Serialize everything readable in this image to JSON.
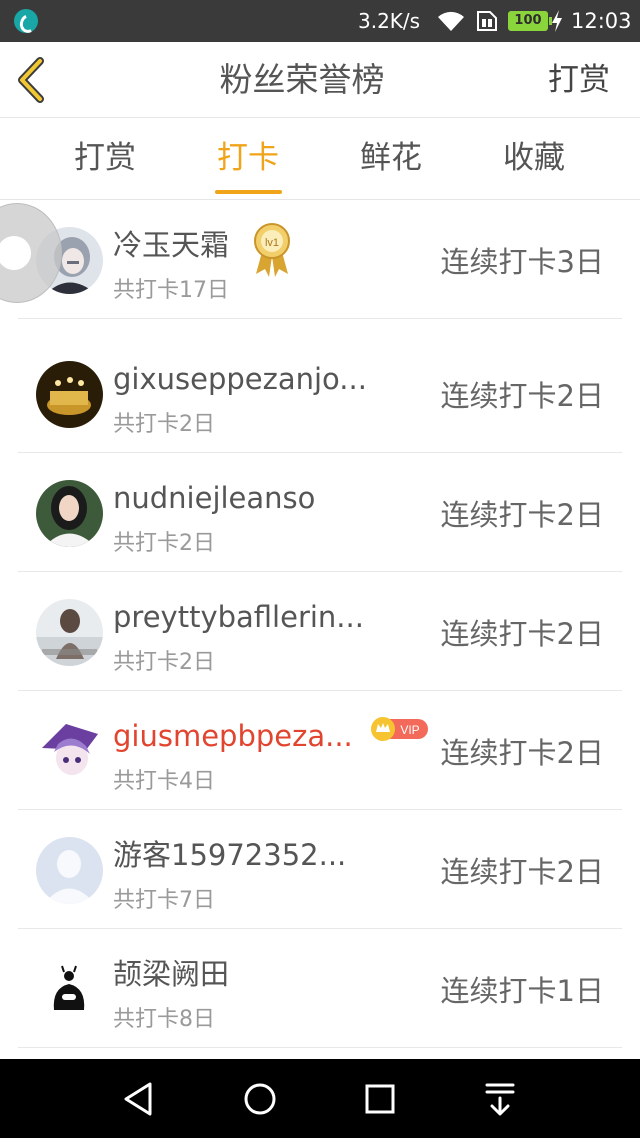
{
  "status_bar": {
    "speed": "3.2K/s",
    "battery": "100",
    "time": "12:03",
    "icons": [
      "app-notification-icon",
      "wifi-icon",
      "sim-icon",
      "battery-icon",
      "charging-icon"
    ]
  },
  "header": {
    "title": "粉丝荣誉榜",
    "right_action": "打赏",
    "back_icon": "chevron-left-icon"
  },
  "tabs": [
    {
      "label": "打赏",
      "active": false
    },
    {
      "label": "打卡",
      "active": true
    },
    {
      "label": "鲜花",
      "active": false
    },
    {
      "label": "收藏",
      "active": false
    }
  ],
  "fans": [
    {
      "name": "冷玉天霜",
      "total": "共打卡17日",
      "streak": "连续打卡3日",
      "badge": "lv1",
      "vip": false
    },
    {
      "name": "gixuseppezanjo...",
      "total": "共打卡2日",
      "streak": "连续打卡2日",
      "vip": false
    },
    {
      "name": "nudniejleanso",
      "total": "共打卡2日",
      "streak": "连续打卡2日",
      "vip": false
    },
    {
      "name": "preyttybafllerin...",
      "total": "共打卡2日",
      "streak": "连续打卡2日",
      "vip": false
    },
    {
      "name": "giusmepbpeza...",
      "total": "共打卡4日",
      "streak": "连续打卡2日",
      "badge": "VIP",
      "vip": true
    },
    {
      "name": "游客15972352...",
      "total": "共打卡7日",
      "streak": "连续打卡2日",
      "vip": false
    },
    {
      "name": "颉梁阙田",
      "total": "共打卡8日",
      "streak": "连续打卡1日",
      "vip": false
    }
  ],
  "colors": {
    "accent": "#f0a419",
    "vip_name": "#e2452f",
    "statusbar": "#3a3a3a",
    "navbar": "#000000"
  },
  "navbar": {
    "icons": [
      "back-triangle-icon",
      "home-circle-icon",
      "recents-square-icon",
      "notification-pulldown-icon"
    ]
  }
}
